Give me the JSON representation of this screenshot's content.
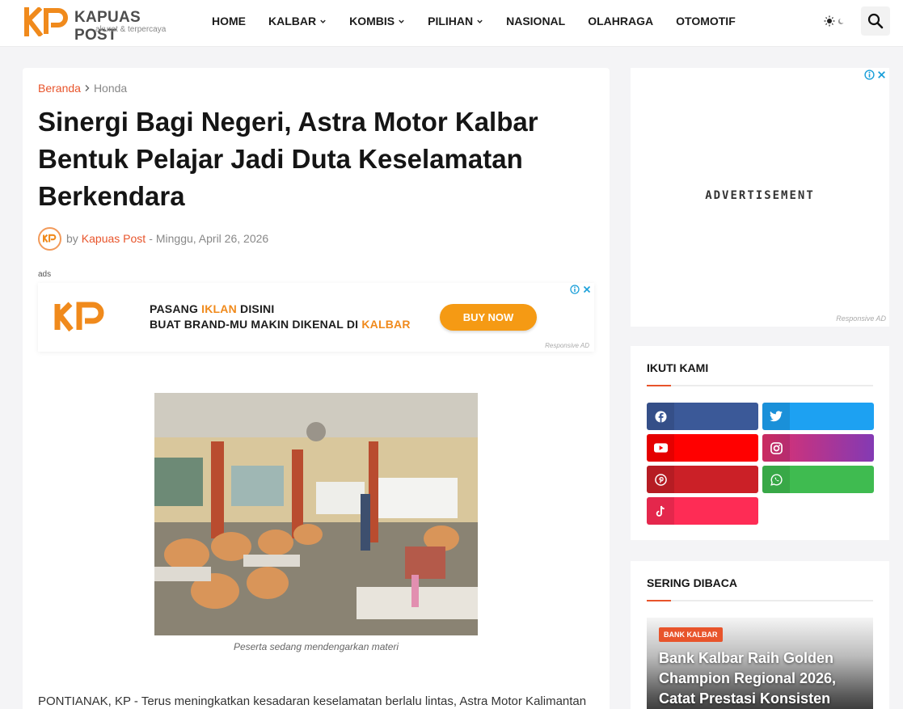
{
  "site": {
    "name": "KAPUAS POST",
    "tagline": "akurat & terpercaya",
    "logo_mark": "KP"
  },
  "nav": {
    "items": [
      {
        "label": "HOME",
        "dropdown": false
      },
      {
        "label": "KALBAR",
        "dropdown": true
      },
      {
        "label": "KOMBIS",
        "dropdown": true
      },
      {
        "label": "PILIHAN",
        "dropdown": true
      },
      {
        "label": "NASIONAL",
        "dropdown": false
      },
      {
        "label": "OLAHRAGA",
        "dropdown": false
      },
      {
        "label": "OTOMOTIF",
        "dropdown": false
      }
    ]
  },
  "breadcrumb": {
    "home": "Beranda",
    "current": "Honda"
  },
  "post": {
    "title": "Sinergi Bagi Negeri, Astra Motor Kalbar Bentuk Pelajar Jadi Duta Keselamatan Berkendara",
    "by": "by",
    "author": "Kapuas Post",
    "date_sep": "-",
    "date": "Minggu, April 26, 2026",
    "image_caption": "Peserta sedang mendengarkan materi",
    "lead": "PONTIANAK, KP - Terus meningkatkan kesadaran keselamatan berlalu lintas, Astra Motor Kalimantan"
  },
  "ads": {
    "label": "ads",
    "banner": {
      "logo": "KP",
      "line1_pre": "PASANG ",
      "line1_hl": "IKLAN",
      "line1_post": " DISINI",
      "line2_pre": "BUAT BRAND-MU MAKIN DIKENAL DI ",
      "line2_hl": "KALBAR",
      "cta": "BUY NOW",
      "responsive": "Responsive AD"
    },
    "sidebar": {
      "text": "ADVERTISEMENT",
      "responsive": "Responsive AD"
    }
  },
  "follow": {
    "title": "IKUTI KAMI",
    "networks": [
      {
        "name": "facebook",
        "icon": "facebook-icon",
        "color": "#3b5998"
      },
      {
        "name": "twitter",
        "icon": "twitter-icon",
        "color": "#1da1f2"
      },
      {
        "name": "youtube",
        "icon": "youtube-icon",
        "color": "#ff0000"
      },
      {
        "name": "instagram",
        "icon": "instagram-icon",
        "color": "#c13584"
      },
      {
        "name": "pinterest",
        "icon": "pinterest-icon",
        "color": "#cb2027"
      },
      {
        "name": "whatsapp",
        "icon": "whatsapp-icon",
        "color": "#3fbb50"
      },
      {
        "name": "tiktok",
        "icon": "tiktok-icon",
        "color": "#fe2c55"
      }
    ]
  },
  "popular": {
    "title": "SERING DIBACA",
    "items": [
      {
        "badge": "BANK KALBAR",
        "title": "Bank Kalbar Raih Golden Champion Regional 2026, Catat Prestasi Konsisten"
      }
    ]
  },
  "colors": {
    "accent": "#e8542b",
    "brand_orange": "#f59a14",
    "background": "#f4f4f6"
  }
}
